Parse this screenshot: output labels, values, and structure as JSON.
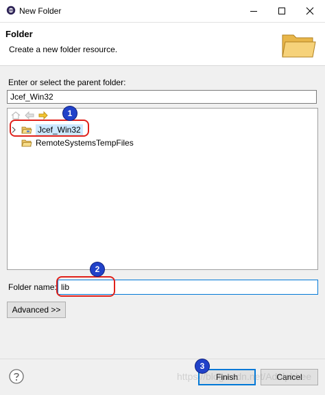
{
  "window": {
    "title": "New Folder",
    "minimize_icon": "minimize-icon",
    "maximize_icon": "maximize-icon",
    "close_icon": "close-icon"
  },
  "banner": {
    "title": "Folder",
    "description": "Create a new folder resource."
  },
  "parent": {
    "label": "Enter or select the parent folder:",
    "value": "Jcef_Win32"
  },
  "tree": {
    "items": [
      {
        "label": "Jcef_Win32",
        "expandable": true,
        "selected": true
      },
      {
        "label": "RemoteSystemsTempFiles",
        "expandable": false,
        "selected": false
      }
    ]
  },
  "folder_name": {
    "label": "Folder name:",
    "value": "lib"
  },
  "advanced": {
    "label": "Advanced >>"
  },
  "buttons": {
    "finish": "Finish",
    "cancel": "Cancel"
  },
  "annotations": {
    "badge_1": "1",
    "badge_2": "2",
    "badge_3": "3"
  },
  "watermark": "https://blog.csdn.net/AdolphLee",
  "colors": {
    "accent": "#0078d7",
    "callout_red": "#e0201a",
    "badge_blue": "#2142c9",
    "selection": "#cce8ff"
  }
}
